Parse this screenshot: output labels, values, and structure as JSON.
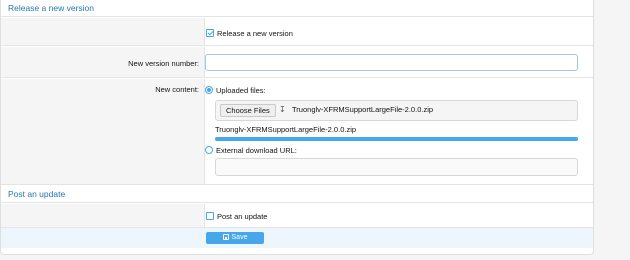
{
  "release_section": {
    "title": "Release a new version",
    "release_checkbox_label": "Release a new version",
    "release_checked": true,
    "version_label": "New version number:",
    "version_value": "",
    "content_label": "New content:",
    "uploaded_files_label": "Uploaded files:",
    "uploaded_files_selected": true,
    "choose_files_label": "Choose Files",
    "chosen_file_name": "Truonglv-XFRMSupportLargeFile-2.0.0.zip",
    "uploaded_file_name": "Truonglv-XFRMSupportLargeFile-2.0.0.zip",
    "upload_progress": 1.0,
    "external_url_label": "External download URL:",
    "external_url_selected": false,
    "external_url_value": ""
  },
  "update_section": {
    "title": "Post an update",
    "post_update_label": "Post an update",
    "post_update_checked": false
  },
  "footer": {
    "save_label": "Save"
  },
  "colors": {
    "accent": "#47a7eb",
    "section_title": "#2577b1",
    "footer_bg": "#edf6fd"
  }
}
